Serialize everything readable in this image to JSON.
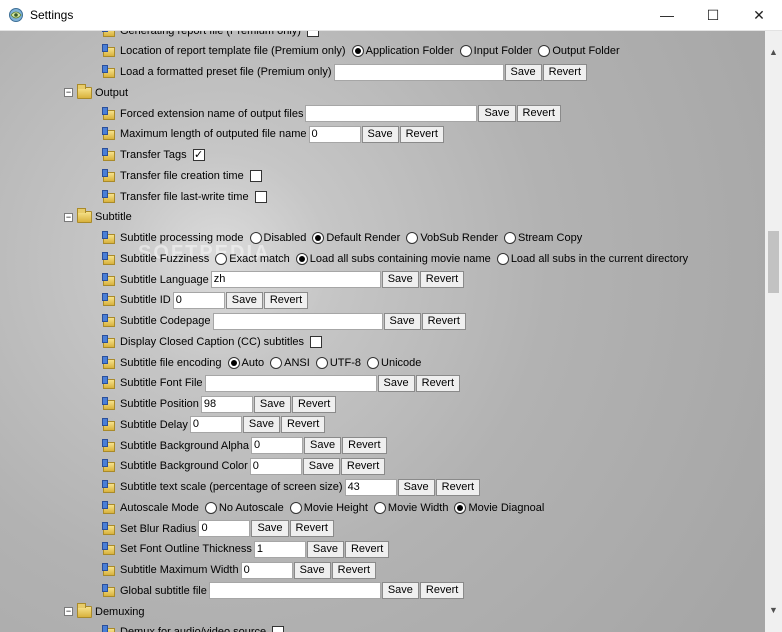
{
  "window": {
    "title": "Settings",
    "min_glyph": "—",
    "max_glyph": "☐",
    "close_glyph": "✕"
  },
  "watermark": "SOFTPEDIA",
  "tree": {
    "expand_glyph": "−",
    "check_glyph": "✓",
    "report_items": [
      {
        "label": "Generating report file (Premium only)",
        "type": "checkbox",
        "checked": false
      },
      {
        "label": "Location of report template file (Premium only)",
        "type": "radio",
        "options": [
          {
            "label": "Application Folder",
            "selected": true
          },
          {
            "label": "Input Folder",
            "selected": false
          },
          {
            "label": "Output Folder",
            "selected": false
          }
        ]
      },
      {
        "label": "Load a formatted preset file (Premium only)",
        "type": "text",
        "value": ""
      }
    ],
    "output": {
      "label": "Output",
      "items": [
        {
          "label": "Forced extension name of output files",
          "type": "text",
          "value": ""
        },
        {
          "label": "Maximum length of outputed file name",
          "type": "text",
          "value": "0"
        },
        {
          "label": "Transfer Tags",
          "type": "checkbox",
          "checked": true
        },
        {
          "label": "Transfer file creation time",
          "type": "checkbox",
          "checked": false
        },
        {
          "label": "Transfer file last-write time",
          "type": "checkbox",
          "checked": false
        }
      ]
    },
    "subtitle": {
      "label": "Subtitle",
      "items": [
        {
          "label": "Subtitle processing mode",
          "type": "radio",
          "options": [
            {
              "label": "Disabled",
              "selected": false
            },
            {
              "label": "Default Render",
              "selected": true
            },
            {
              "label": "VobSub Render",
              "selected": false
            },
            {
              "label": "Stream Copy",
              "selected": false
            }
          ]
        },
        {
          "label": "Subtitle Fuzziness",
          "type": "radio",
          "options": [
            {
              "label": "Exact match",
              "selected": false
            },
            {
              "label": "Load all subs containing movie name",
              "selected": true
            },
            {
              "label": "Load all subs in the current directory",
              "selected": false
            }
          ]
        },
        {
          "label": "Subtitle Language",
          "type": "text",
          "value": "zh"
        },
        {
          "label": "Subtitle ID",
          "type": "text",
          "value": "0"
        },
        {
          "label": "Subtitle Codepage",
          "type": "text",
          "value": ""
        },
        {
          "label": "Display Closed Caption (CC) subtitles",
          "type": "checkbox",
          "checked": false
        },
        {
          "label": "Subtitle file encoding",
          "type": "radio",
          "options": [
            {
              "label": "Auto",
              "selected": true
            },
            {
              "label": "ANSI",
              "selected": false
            },
            {
              "label": "UTF-8",
              "selected": false
            },
            {
              "label": "Unicode",
              "selected": false
            }
          ]
        },
        {
          "label": "Subtitle Font File",
          "type": "text",
          "value": ""
        },
        {
          "label": "Subtitle Position",
          "type": "text",
          "value": "98"
        },
        {
          "label": "Subtitle Delay",
          "type": "text",
          "value": "0"
        },
        {
          "label": "Subtitle Background Alpha",
          "type": "text",
          "value": "0"
        },
        {
          "label": "Subtitle Background Color",
          "type": "text",
          "value": "0"
        },
        {
          "label": "Subtitle text scale (percentage of screen size)",
          "type": "text",
          "value": "43"
        },
        {
          "label": "Autoscale Mode",
          "type": "radio",
          "options": [
            {
              "label": "No Autoscale",
              "selected": false
            },
            {
              "label": "Movie Height",
              "selected": false
            },
            {
              "label": "Movie Width",
              "selected": false
            },
            {
              "label": "Movie Diagnoal",
              "selected": true
            }
          ]
        },
        {
          "label": "Set Blur Radius",
          "type": "text",
          "value": "0"
        },
        {
          "label": "Set Font Outline Thickness",
          "type": "text",
          "value": "1"
        },
        {
          "label": "Subtitle Maximum Width",
          "type": "text",
          "value": "0"
        },
        {
          "label": "Global subtitle file",
          "type": "text",
          "value": ""
        }
      ]
    },
    "demuxing": {
      "label": "Demuxing",
      "items": [
        {
          "label": "Demux for audio/video source",
          "type": "checkbox",
          "checked": false
        }
      ]
    }
  },
  "buttons": {
    "save": "Save",
    "revert": "Revert"
  }
}
